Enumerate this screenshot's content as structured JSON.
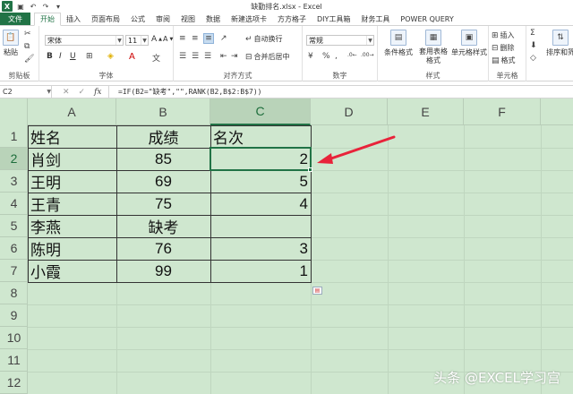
{
  "window": {
    "title": "缺勤排名.xlsx - Excel"
  },
  "tabs": [
    "文件",
    "开始",
    "插入",
    "页面布局",
    "公式",
    "审阅",
    "视图",
    "数据",
    "新建选项卡",
    "方方格子",
    "DIY工具箱",
    "财务工具",
    "POWER QUERY"
  ],
  "active_tab": "开始",
  "ribbon": {
    "clipboard": {
      "label": "剪贴板",
      "paste": "粘贴"
    },
    "font": {
      "label": "字体",
      "name": "宋体",
      "size": "11"
    },
    "alignment": {
      "label": "对齐方式",
      "wrap": "自动换行",
      "merge": "合并后居中"
    },
    "number": {
      "label": "数字",
      "format": "常规"
    },
    "styles": {
      "label": "样式",
      "conditional": "条件格式",
      "table": "套用表格格式",
      "cell_styles": "单元格样式"
    },
    "cells": {
      "label": "单元格",
      "insert": "插入",
      "delete": "删除",
      "format": "格式"
    },
    "editing": {
      "sort_filter": "排序和筛"
    }
  },
  "formula_bar": {
    "name_box": "C2",
    "fx": "fx",
    "formula": "=IF(B2=\"缺考\",\"\",RANK(B2,B$2:B$7))"
  },
  "columns": [
    "A",
    "B",
    "C",
    "D",
    "E",
    "F"
  ],
  "rows": [
    "1",
    "2",
    "3",
    "4",
    "5",
    "6",
    "7",
    "8",
    "9",
    "10",
    "11",
    "12"
  ],
  "sheet": {
    "headers": [
      "姓名",
      "成绩",
      "名次"
    ],
    "data": [
      [
        "肖剑",
        "85",
        "2"
      ],
      [
        "王明",
        "69",
        "5"
      ],
      [
        "王青",
        "75",
        "4"
      ],
      [
        "李燕",
        "缺考",
        ""
      ],
      [
        "陈明",
        "76",
        "3"
      ],
      [
        "小霞",
        "99",
        "1"
      ]
    ]
  },
  "colors": {
    "accent": "#217346",
    "grid_bg": "#cfe7cf",
    "arrow": "#e8233a"
  },
  "watermark": "头条 @EXCEL学习宫"
}
